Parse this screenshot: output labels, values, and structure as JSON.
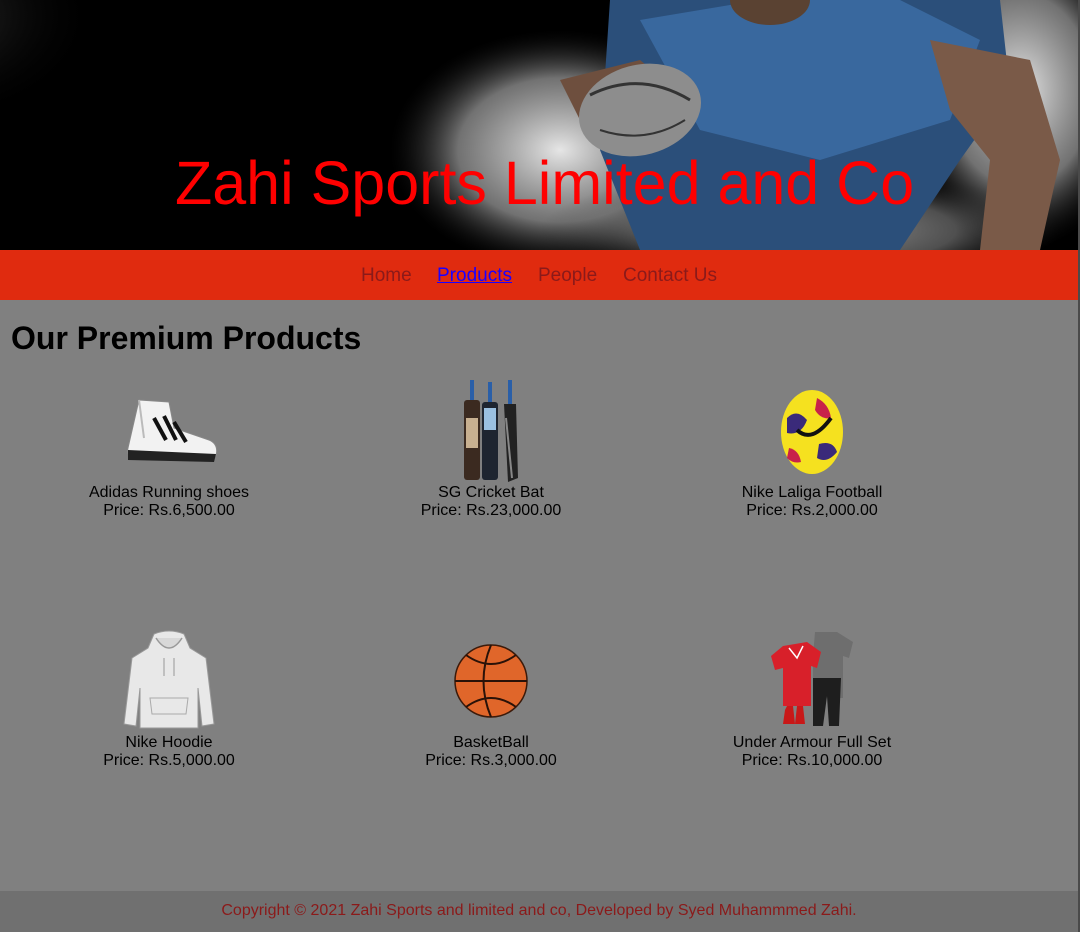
{
  "header": {
    "title": "Zahi Sports Limited and Co",
    "title_color": "#ff0000",
    "banner_image": "rugby-player-dust-photo"
  },
  "nav": {
    "background": "#e02b0f",
    "items": [
      {
        "label": "Home",
        "active": false
      },
      {
        "label": "Products",
        "active": true
      },
      {
        "label": "People",
        "active": false
      },
      {
        "label": "Contact Us",
        "active": false
      }
    ]
  },
  "main": {
    "heading": "Our Premium Products",
    "products": [
      {
        "name": "Adidas Running shoes",
        "price": "Price: Rs.6,500.00",
        "icon": "shoe-icon"
      },
      {
        "name": "SG Cricket Bat",
        "price": "Price: Rs.23,000.00",
        "icon": "cricket-bat-icon"
      },
      {
        "name": "Nike Laliga Football",
        "price": "Price: Rs.2,000.00",
        "icon": "football-icon"
      },
      {
        "name": "Nike Hoodie",
        "price": "Price: Rs.5,000.00",
        "icon": "hoodie-icon"
      },
      {
        "name": "BasketBall",
        "price": "Price: Rs.3,000.00",
        "icon": "basketball-icon"
      },
      {
        "name": "Under Armour Full Set",
        "price": "Price: Rs.10,000.00",
        "icon": "sports-kit-icon"
      }
    ]
  },
  "footer": {
    "text": "Copyright © 2021 Zahi Sports and limited and co, Developed by Syed Muhammmed Zahi."
  }
}
